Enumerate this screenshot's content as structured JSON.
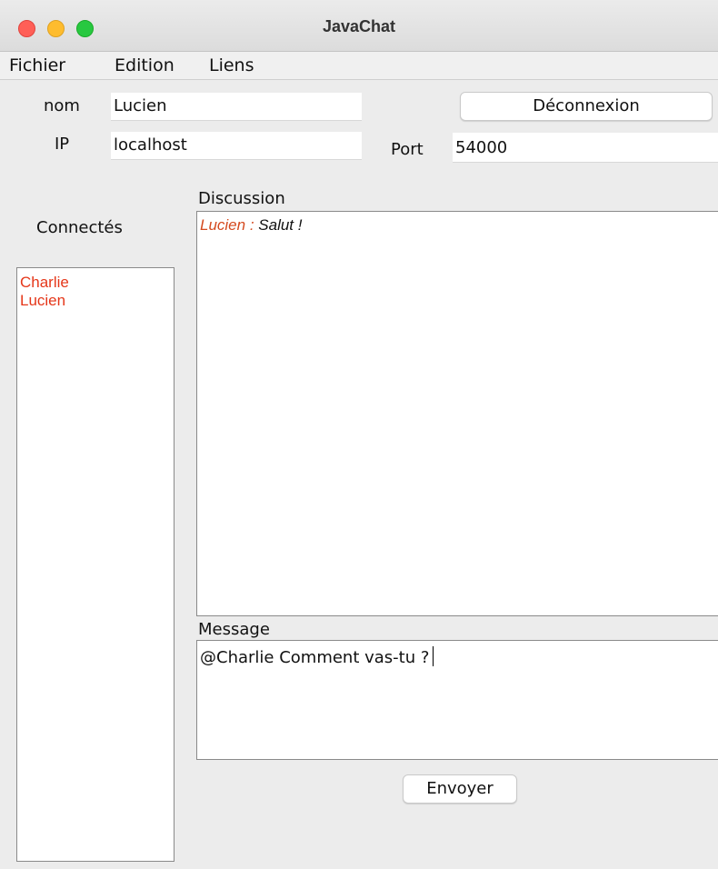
{
  "window": {
    "title": "JavaChat"
  },
  "colors": {
    "close": "#ff5f57",
    "minimize": "#febc2e",
    "zoom": "#28c840",
    "user_text": "#e5371a"
  },
  "menu": {
    "items": [
      "Fichier",
      "Edition",
      "Liens"
    ]
  },
  "form": {
    "nom_label": "nom",
    "nom_value": "Lucien",
    "ip_label": "IP",
    "ip_value": "localhost",
    "port_label": "Port",
    "port_value": "54000",
    "disconnect_label": "Déconnexion"
  },
  "connected": {
    "title": "Connectés",
    "users": [
      "Charlie",
      "Lucien"
    ]
  },
  "discussion": {
    "title": "Discussion",
    "messages": [
      {
        "user": "Lucien :",
        "text": "Salut !"
      }
    ]
  },
  "message": {
    "title": "Message",
    "draft": "@Charlie Comment vas-tu ?"
  },
  "send_label": "Envoyer"
}
